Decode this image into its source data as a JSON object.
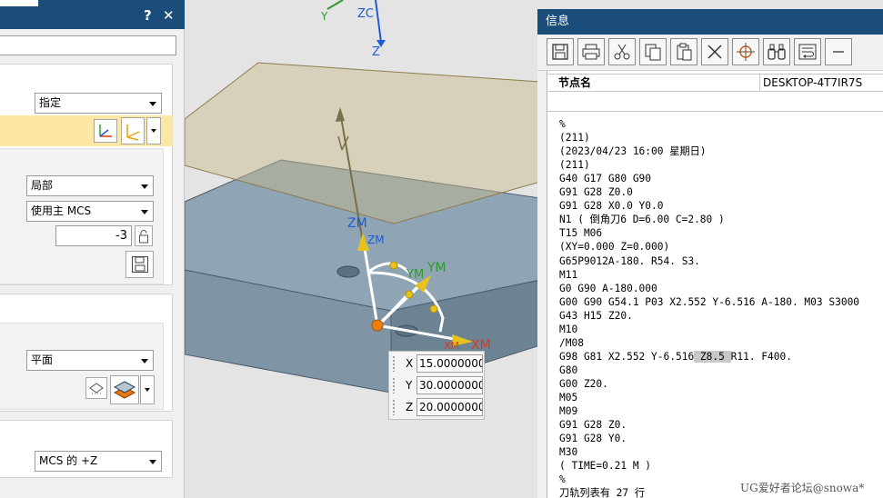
{
  "left_dialog": {
    "help_glyph": "?",
    "close_glyph": "✕",
    "combo_specify": "指定",
    "combo_local": "局部",
    "combo_use_main_mcs": "使用主 MCS",
    "number_value": "-3",
    "combo_plane": "平面",
    "combo_mcs_z": "MCS 的 +Z"
  },
  "viewport": {
    "label_zc": "ZC",
    "label_y": "Y",
    "label_z": "Z",
    "label_zm_1": "ZM",
    "label_zm_2": "ZM",
    "label_ym_1": "YM",
    "label_ym_2": "YM",
    "label_xm_1": "XM",
    "label_xm_2": "XM"
  },
  "coord_input": {
    "x_label": "X",
    "x_value": "15.0000000",
    "y_label": "Y",
    "y_value": "30.0000000",
    "z_label": "Z",
    "z_value": "20.0000000"
  },
  "info_window": {
    "title": "信息",
    "toolbar_icons": [
      "save-icon",
      "print-icon",
      "cut-icon",
      "copy-icon",
      "paste-icon",
      "delete-icon",
      "target-icon",
      "binoculars-icon",
      "wrap-text-icon",
      "minus-icon"
    ],
    "node_label": "节点名",
    "node_value": "DESKTOP-4T7IR7S",
    "nc_lines": [
      "%",
      "(211)",
      "(2023/04/23 16:00 星期日)",
      "(211)",
      "G40 G17 G80 G90",
      "G91 G28 Z0.0",
      "G91 G28 X0.0 Y0.0",
      "N1 ( 倒角刀6 D=6.00 C=2.80 )",
      "T15 M06",
      "(XY=0.000 Z=0.000)",
      "G65P9012A-180. R54. S3.",
      "M11",
      "G0 G90 A-180.000",
      "G00 G90 G54.1 P03 X2.552 Y-6.516 A-180. M03 S3000",
      "G43 H15 Z20.",
      "M10",
      "/M08",
      "G80",
      "G00 Z20.",
      "M05",
      "M09",
      "G91 G28 Z0.",
      "G91 G28 Y0.",
      "M30",
      "( TIME=0.21 M )",
      "%",
      "刀轨列表有 27 行"
    ],
    "nc_hl_line": {
      "pre": "G98 G81 X2.552 Y-6.516",
      "hl": " Z8.5 ",
      "post": "R11. F400."
    }
  },
  "watermark": "UG爱好者论坛@snowa*",
  "colors": {
    "title_bar": "#1a4d79",
    "highlight_row": "#fde7a5",
    "block_face": "#8fa4b4",
    "plane": "#c8b88a",
    "axis_z": "#1f5bd6",
    "axis_x": "#e0351f",
    "axis_y": "#2e9a2e",
    "handle_yellow": "#e8c21c",
    "origin_orange": "#ee7d10"
  }
}
